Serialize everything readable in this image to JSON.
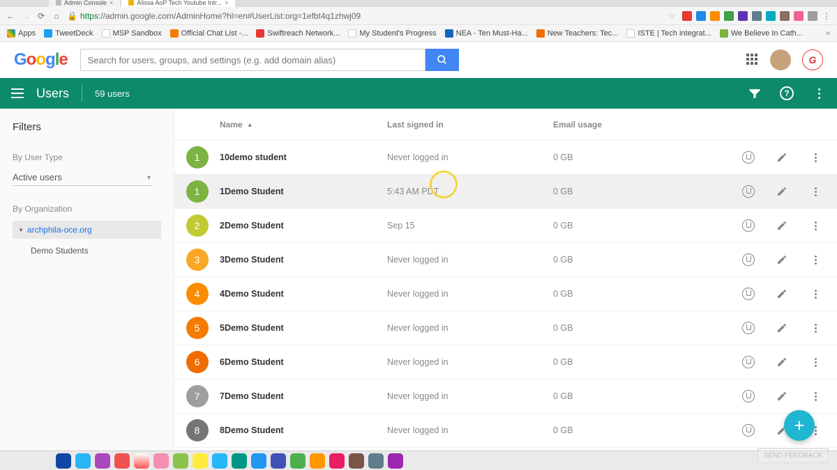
{
  "browser": {
    "tabs": [
      {
        "title": "Admin Console"
      },
      {
        "title": "Alissa AoP Tech Youtube Intr..."
      }
    ],
    "url_https": "https",
    "url_host": "://admin.google.com",
    "url_path": "/AdminHome?hl=en#UserList:org=1efbt4q1zhwj09",
    "bookmarks": [
      "Apps",
      "TweetDeck",
      "MSP Sandbox",
      "Official Chat List -...",
      "Swiftreach Network...",
      "My Student's Progress",
      "NEA - Ten Must-Ha...",
      "New Teachers: Tec...",
      "ISTE | Tech integrat...",
      "We Believe In Cath..."
    ]
  },
  "header": {
    "logo": [
      "G",
      "o",
      "o",
      "g",
      "l",
      "e"
    ],
    "search_placeholder": "Search for users, groups, and settings (e.g. add domain alias)"
  },
  "teal": {
    "title": "Users",
    "subtitle": "59 users"
  },
  "sidebar": {
    "filters_title": "Filters",
    "user_type_label": "By User Type",
    "user_type_value": "Active users",
    "org_label": "By Organization",
    "org_root": "archphila-oce.org",
    "org_child": "Demo Students"
  },
  "table": {
    "col_name": "Name",
    "col_last": "Last signed in",
    "col_email": "Email usage",
    "rows": [
      {
        "initial": "1",
        "color": "#7cb342",
        "name": "10demo student",
        "last": "Never logged in",
        "email": "0 GB"
      },
      {
        "initial": "1",
        "color": "#7cb342",
        "name": "1Demo Student",
        "last": "5:43 AM PDT",
        "email": "0 GB",
        "hover": true
      },
      {
        "initial": "2",
        "color": "#c0ca33",
        "name": "2Demo Student",
        "last": "Sep 15",
        "email": "0 GB"
      },
      {
        "initial": "3",
        "color": "#f9a825",
        "name": "3Demo Student",
        "last": "Never logged in",
        "email": "0 GB"
      },
      {
        "initial": "4",
        "color": "#fb8c00",
        "name": "4Demo Student",
        "last": "Never logged in",
        "email": "0 GB"
      },
      {
        "initial": "5",
        "color": "#f57c00",
        "name": "5Demo Student",
        "last": "Never logged in",
        "email": "0 GB"
      },
      {
        "initial": "6",
        "color": "#ef6c00",
        "name": "6Demo Student",
        "last": "Never logged in",
        "email": "0 GB"
      },
      {
        "initial": "7",
        "color": "#9e9e9e",
        "name": "7Demo Student",
        "last": "Never logged in",
        "email": "0 GB"
      },
      {
        "initial": "8",
        "color": "#757575",
        "name": "8Demo Student",
        "last": "Never logged in",
        "email": "0 GB"
      }
    ]
  },
  "footer": {
    "feedback": "SEND FEEDBACK",
    "fab": "+"
  }
}
